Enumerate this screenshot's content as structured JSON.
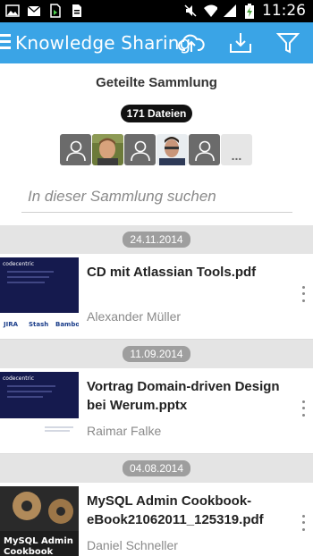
{
  "statusbar": {
    "time": "11:26"
  },
  "appbar": {
    "title": "Knowledge Sharing"
  },
  "collection": {
    "title": "Geteilte Sammlung",
    "count_label": "171 Dateien",
    "more_members": "..."
  },
  "search": {
    "placeholder": "In dieser Sammlung suchen"
  },
  "groups": [
    {
      "date": "24.11.2014",
      "file": {
        "name": "CD mit Atlassian Tools.pdf",
        "owner": "Alexander Müller"
      }
    },
    {
      "date": "11.09.2014",
      "file": {
        "name": "Vortrag Domain-driven Design bei Werum.pptx",
        "owner": "Raimar Falke"
      }
    },
    {
      "date": "04.08.2014",
      "file": {
        "name": "MySQL Admin Cookbook-eBook21062011_125319.pdf",
        "owner": "Daniel Schneller"
      }
    }
  ],
  "thumbs": {
    "t1": {
      "line1": "codecentric",
      "logos": [
        "JIRA",
        "Stash",
        "Bamboo"
      ]
    },
    "t2": {
      "line1": "codecentric"
    },
    "t3": {
      "line1": "MySQL Admin",
      "line2": "Cookbook"
    }
  }
}
